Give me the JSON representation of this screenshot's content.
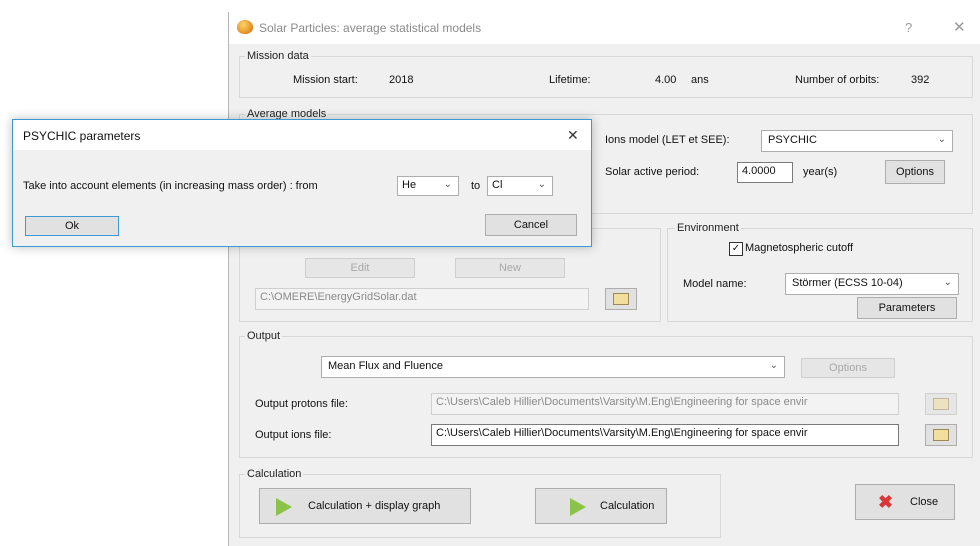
{
  "window": {
    "title": "Solar Particles: average statistical models",
    "help": "?",
    "close": "✕"
  },
  "mission": {
    "group_label": "Mission data",
    "start_label": "Mission start:",
    "start_value": "2018",
    "lifetime_label": "Lifetime:",
    "lifetime_value": "4.00",
    "lifetime_unit": "ans",
    "orbits_label": "Number of orbits:",
    "orbits_value": "392"
  },
  "average": {
    "group_label": "Average models",
    "ions_label": "Ions model (LET et SEE):",
    "ions_value": "PSYCHIC",
    "solar_label": "Solar active period:",
    "solar_value": "4.0000",
    "solar_unit": "year(s)",
    "options": "Options"
  },
  "energy": {
    "edit": "Edit",
    "new": "New",
    "path": "C:\\OMERE\\EnergyGridSolar.dat"
  },
  "environment": {
    "group_label": "Environment",
    "cutoff_label": "Magnetospheric cutoff",
    "cutoff_checked": true,
    "model_label": "Model name:",
    "model_value": "Störmer (ECSS 10-04)",
    "parameters": "Parameters"
  },
  "output": {
    "group_label": "Output",
    "mode_value": "Mean Flux and Fluence",
    "options": "Options",
    "protons_label": "Output protons file:",
    "protons_path": "C:\\Users\\Caleb Hillier\\Documents\\Varsity\\M.Eng\\Engineering for space envir",
    "ions_label": "Output ions file:",
    "ions_path": "C:\\Users\\Caleb Hillier\\Documents\\Varsity\\M.Eng\\Engineering for space envir"
  },
  "calculation": {
    "group_label": "Calculation",
    "calc_graph": "Calculation + display graph",
    "calc": "Calculation",
    "close": "Close"
  },
  "dialog": {
    "title": "PSYCHIC parameters",
    "close": "✕",
    "prompt": "Take into account elements (in increasing mass order) : from",
    "from_value": "He",
    "to_label": "to",
    "to_value": "Cl",
    "ok": "Ok",
    "cancel": "Cancel"
  },
  "colors": {
    "accent_border": "#3d99d6",
    "play_green": "#8bc34a",
    "close_red": "#d9383a"
  }
}
